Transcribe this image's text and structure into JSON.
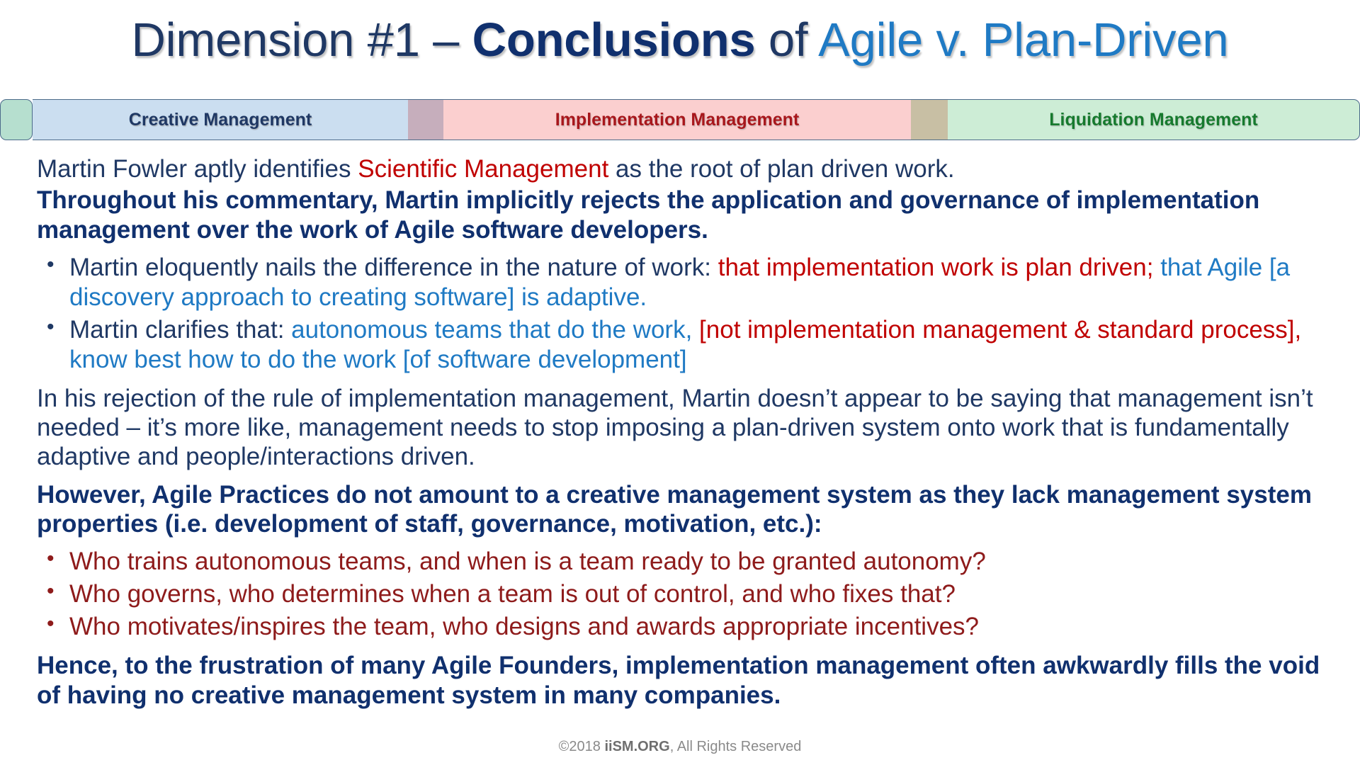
{
  "title": {
    "part1": "Dimension #1 – ",
    "part2": "Conclusions",
    "part3": " of ",
    "part4": "Agile v. Plan-Driven"
  },
  "banner": {
    "segments": [
      {
        "name": "green-cap",
        "label": "",
        "color": "#B6DFCF"
      },
      {
        "name": "creative",
        "label": "Creative Management",
        "color": "#CBDEF0",
        "text_color": "#1F3864"
      },
      {
        "name": "gap1",
        "label": "",
        "color": "#C6AEBC"
      },
      {
        "name": "implementation",
        "label": "Implementation Management",
        "color": "#FBCFCF",
        "text_color": "#A8171C"
      },
      {
        "name": "gap2",
        "label": "",
        "color": "#C8BFA4"
      },
      {
        "name": "liquidation",
        "label": "Liquidation Management",
        "color": "#CDEDD6",
        "text_color": "#167A2E"
      }
    ]
  },
  "body": {
    "p1": {
      "a": "Martin Fowler aptly identifies ",
      "b": "Scientific Management",
      "c": " as the root of plan driven work."
    },
    "p2": "Throughout his commentary, Martin implicitly rejects the application and governance of implementation management over the work of Agile software developers.",
    "bullets_top": [
      {
        "a": "Martin eloquently nails the difference in the nature of work: ",
        "b": "that implementation work is plan driven;",
        "c": " that Agile [a discovery approach to creating software] is adaptive."
      },
      {
        "a": "Martin clarifies that: ",
        "b": "autonomous teams that do the work, ",
        "c": "[not implementation management & standard process],",
        "d": " know best how to do the work [of software development]"
      }
    ],
    "p3": "In his rejection of the rule of implementation management, Martin doesn’t appear to be saying that management isn’t needed – it’s more like, management needs to stop imposing a plan-driven system onto work that is fundamentally adaptive and people/interactions driven.",
    "p4": "However, Agile Practices do not amount to a creative management system as they lack management system properties (i.e. development of staff, governance, motivation, etc.):",
    "bullets_red": [
      "Who trains autonomous teams, and when is a team ready to be granted autonomy?",
      "Who governs, who determines when a team is out of control, and who fixes that?",
      "Who motivates/inspires the team, who designs and awards appropriate incentives?"
    ],
    "p5": "Hence, to the frustration of many Agile Founders, implementation management often awkwardly fills the void of having no creative management system in many companies."
  },
  "footer": {
    "copyright": "©2018 ",
    "org": "iiSM.ORG",
    "rights": ",  All Rights Reserved"
  },
  "colors": {
    "title_dark": "#1F3864",
    "title_bold": "#10306E",
    "title_light": "#1F7AC4",
    "body_blue": "#1F3864",
    "accent_red": "#C00000",
    "question_red": "#8E1B1B",
    "light_blue": "#1F7AC4"
  }
}
